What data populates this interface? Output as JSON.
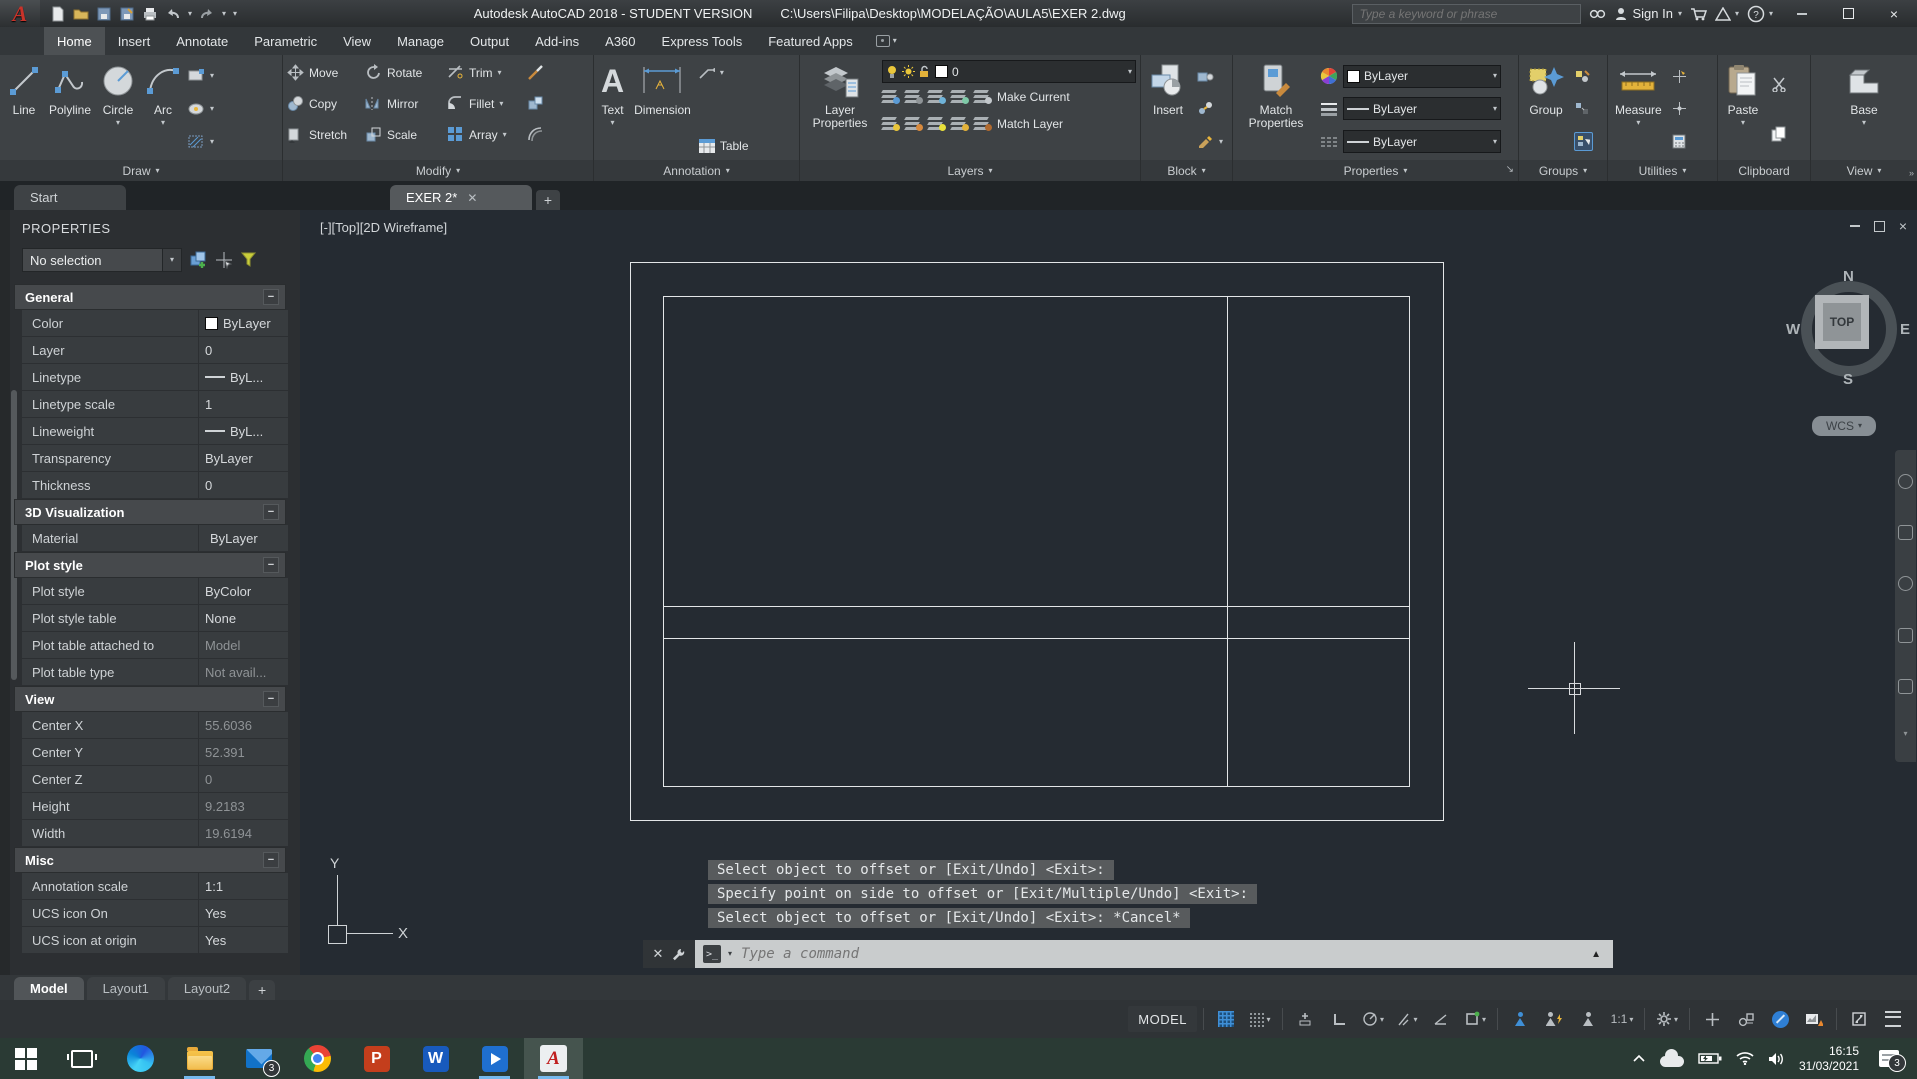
{
  "title_bar": {
    "app_title": "Autodesk AutoCAD 2018 - STUDENT VERSION",
    "file_path": "C:\\Users\\Filipa\\Desktop\\MODELAÇÃO\\AULA5\\EXER 2.dwg",
    "search_placeholder": "Type a keyword or phrase",
    "sign_in": "Sign In"
  },
  "ribbon_tabs": [
    "Home",
    "Insert",
    "Annotate",
    "Parametric",
    "View",
    "Manage",
    "Output",
    "Add-ins",
    "A360",
    "Express Tools",
    "Featured Apps"
  ],
  "ribbon": {
    "draw": {
      "label": "Draw",
      "line": "Line",
      "polyline": "Polyline",
      "circle": "Circle",
      "arc": "Arc"
    },
    "modify": {
      "label": "Modify",
      "move": "Move",
      "rotate": "Rotate",
      "trim": "Trim",
      "copy": "Copy",
      "mirror": "Mirror",
      "fillet": "Fillet",
      "stretch": "Stretch",
      "scale": "Scale",
      "array": "Array"
    },
    "annotation": {
      "label": "Annotation",
      "text": "Text",
      "dimension": "Dimension",
      "table": "Table"
    },
    "layers": {
      "label": "Layers",
      "layer_properties": "Layer Properties",
      "make_current": "Make Current",
      "match_layer": "Match Layer",
      "current_layer": "0"
    },
    "block": {
      "label": "Block",
      "insert": "Insert"
    },
    "properties": {
      "label": "Properties",
      "match_properties": "Match Properties",
      "color_value": "ByLayer",
      "lineweight_value": "ByLayer",
      "linetype_value": "ByLayer"
    },
    "groups": {
      "label": "Groups",
      "group": "Group"
    },
    "utilities": {
      "label": "Utilities",
      "measure": "Measure"
    },
    "clipboard": {
      "label": "Clipboard",
      "paste": "Paste"
    },
    "view": {
      "label": "View",
      "base": "Base"
    }
  },
  "file_tabs": {
    "start": "Start",
    "drawing": "EXER 2*"
  },
  "palette": {
    "title": "PROPERTIES",
    "selection": "No selection",
    "sections": {
      "general": "General",
      "viz": "3D Visualization",
      "plot": "Plot style",
      "view": "View",
      "misc": "Misc"
    },
    "rows": {
      "color": {
        "label": "Color",
        "value": "ByLayer"
      },
      "layer": {
        "label": "Layer",
        "value": "0"
      },
      "linetype": {
        "label": "Linetype",
        "value": "ByL..."
      },
      "linetype_scale": {
        "label": "Linetype scale",
        "value": "1"
      },
      "lineweight": {
        "label": "Lineweight",
        "value": "ByL..."
      },
      "transparency": {
        "label": "Transparency",
        "value": "ByLayer"
      },
      "thickness": {
        "label": "Thickness",
        "value": "0"
      },
      "material": {
        "label": "Material",
        "value": "ByLayer"
      },
      "plot_style": {
        "label": "Plot style",
        "value": "ByColor"
      },
      "plot_style_table": {
        "label": "Plot style table",
        "value": "None"
      },
      "plot_table_attached": {
        "label": "Plot table attached to",
        "value": "Model"
      },
      "plot_table_type": {
        "label": "Plot table type",
        "value": "Not avail..."
      },
      "center_x": {
        "label": "Center X",
        "value": "55.6036"
      },
      "center_y": {
        "label": "Center Y",
        "value": "52.391"
      },
      "center_z": {
        "label": "Center Z",
        "value": "0"
      },
      "height": {
        "label": "Height",
        "value": "9.2183"
      },
      "width": {
        "label": "Width",
        "value": "19.6194"
      },
      "annotation_scale": {
        "label": "Annotation scale",
        "value": "1:1"
      },
      "ucs_icon_on": {
        "label": "UCS icon On",
        "value": "Yes"
      },
      "ucs_icon_origin": {
        "label": "UCS icon at origin",
        "value": "Yes"
      }
    }
  },
  "viewport": {
    "label": "[-][Top][2D Wireframe]",
    "viewcube": {
      "n": "N",
      "s": "S",
      "e": "E",
      "w": "W",
      "top": "TOP",
      "wcs": "WCS"
    },
    "ucs": {
      "x": "X",
      "y": "Y"
    }
  },
  "command": {
    "history": [
      "Select object to offset or [Exit/Undo] <Exit>:",
      "Specify point on side to offset or [Exit/Multiple/Undo] <Exit>:",
      "Select object to offset or [Exit/Undo] <Exit>: *Cancel*"
    ],
    "placeholder": "Type a command"
  },
  "layout_tabs": {
    "model": "Model",
    "layout1": "Layout1",
    "layout2": "Layout2"
  },
  "status_bar": {
    "model": "MODEL",
    "scale": "1:1"
  },
  "taskbar": {
    "time": "16:15",
    "date": "31/03/2021",
    "mail_badge": "3",
    "notification_badge": "3"
  }
}
